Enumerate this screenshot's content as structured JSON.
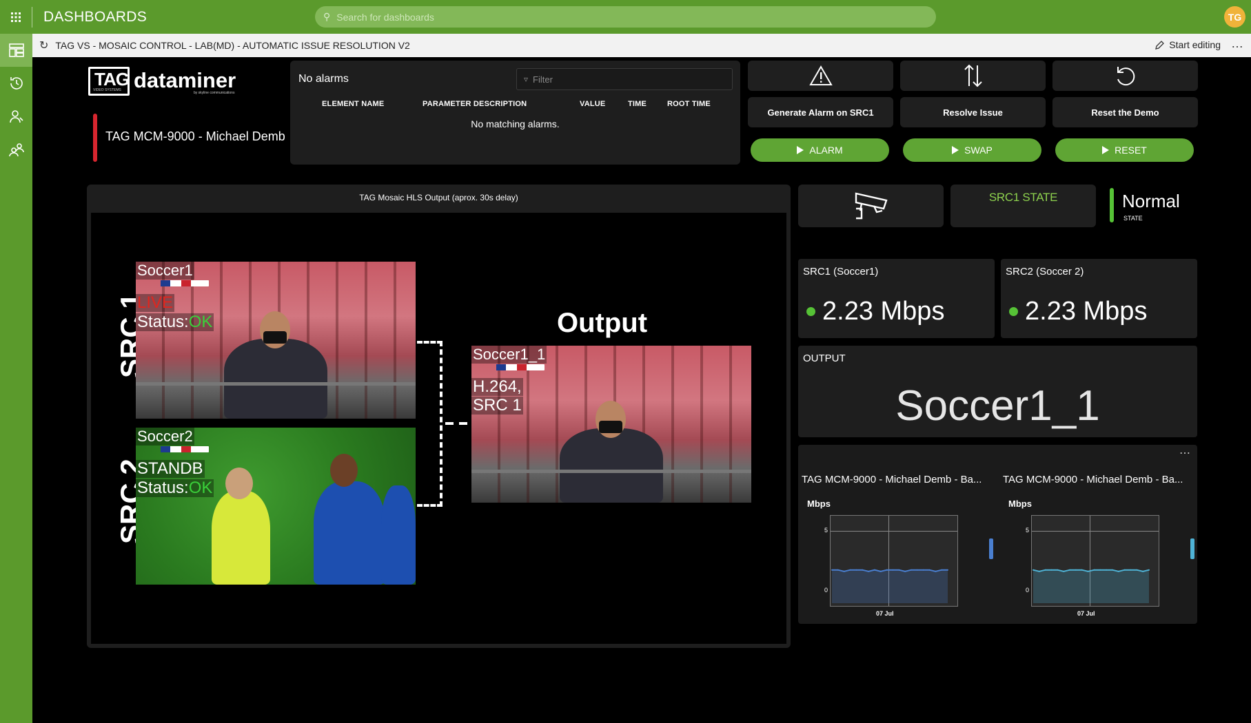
{
  "app": {
    "title": "DASHBOARDS",
    "search_placeholder": "Search for dashboards",
    "avatar": "TG"
  },
  "sidebar": {
    "items": [
      {
        "icon": "dashboards-icon",
        "active": true
      },
      {
        "icon": "history-icon"
      },
      {
        "icon": "user-icon"
      },
      {
        "icon": "users-group-icon"
      }
    ]
  },
  "titlebar": {
    "title": "TAG VS - MOSAIC CONTROL - LAB(MD) - AUTOMATIC ISSUE RESOLUTION V2",
    "start_editing": "Start editing",
    "more": "…"
  },
  "logo": {
    "tag": "TAG",
    "brand": "dataminer",
    "tag_sub": "VIDEO SYSTEMS",
    "brand_sub": "by skyline communications"
  },
  "element": {
    "name": "TAG MCM-9000 - Michael Demb"
  },
  "alarms": {
    "title": "No alarms",
    "filter_placeholder": "Filter",
    "columns": [
      "ELEMENT NAME",
      "PARAMETER DESCRIPTION",
      "VALUE",
      "TIME",
      "ROOT TIME"
    ],
    "empty_text": "No matching alarms."
  },
  "actions": [
    {
      "label": "Generate Alarm on SRC1",
      "icon": "warning-icon",
      "button": "ALARM"
    },
    {
      "label": "Resolve Issue",
      "icon": "swap-arrows-icon",
      "button": "SWAP"
    },
    {
      "label": "Reset the Demo",
      "icon": "undo-icon",
      "button": "RESET"
    }
  ],
  "video": {
    "title": "TAG Mosaic HLS Output (aprox. 30s delay)",
    "src1_label": "SRC 1",
    "src2_label": "SRC 2",
    "output_label": "Output",
    "src1_name": "Soccer1",
    "src1_live": "LIVE",
    "src1_status_prefix": "Status:",
    "src1_status": "OK",
    "src2_name": "Soccer2",
    "src2_mode": "STANDB",
    "src2_status_prefix": "Status:",
    "src2_status": "OK",
    "out_name": "Soccer1_1",
    "out_codec": "H.264,",
    "out_src": "SRC 1"
  },
  "state": {
    "icon": "camera-icon",
    "label": "SRC1 STATE",
    "value": "Normal",
    "sub": "STATE",
    "color": "#56c236"
  },
  "bitrates": [
    {
      "name": "SRC1 (Soccer1)",
      "value": "2.23 Mbps"
    },
    {
      "name": "SRC2 (Soccer 2)",
      "value": "2.23 Mbps"
    }
  ],
  "output": {
    "label": "OUTPUT",
    "value": "Soccer1_1"
  },
  "charts_panel": {
    "more": "⋯"
  },
  "chart_data": [
    {
      "type": "area",
      "title": "TAG MCM-9000 - Michael Demb - Ba...",
      "ylabel": "Mbps",
      "ylim": [
        0,
        5
      ],
      "yticks": [
        "5",
        "0"
      ],
      "xlabel": "",
      "xticks": [
        "07 Jul"
      ],
      "color": "#4a7fd0",
      "series": [
        {
          "values": [
            2.3,
            2.3,
            2.2,
            2.3,
            2.3,
            2.3,
            2.2,
            2.3,
            2.2,
            2.3,
            2.3,
            2.3,
            2.2,
            2.3,
            2.3,
            2.3,
            2.3,
            2.2,
            2.3,
            2.3
          ]
        }
      ]
    },
    {
      "type": "area",
      "title": "TAG MCM-9000 - Michael Demb - Ba...",
      "ylabel": "Mbps",
      "ylim": [
        0,
        5
      ],
      "yticks": [
        "5",
        "0"
      ],
      "xlabel": "",
      "xticks": [
        "07 Jul"
      ],
      "color": "#4fb3d6",
      "series": [
        {
          "values": [
            2.3,
            2.2,
            2.3,
            2.3,
            2.3,
            2.2,
            2.3,
            2.3,
            2.3,
            2.2,
            2.3,
            2.3,
            2.3,
            2.3,
            2.2,
            2.3,
            2.3,
            2.3,
            2.2,
            2.3
          ]
        }
      ]
    }
  ]
}
